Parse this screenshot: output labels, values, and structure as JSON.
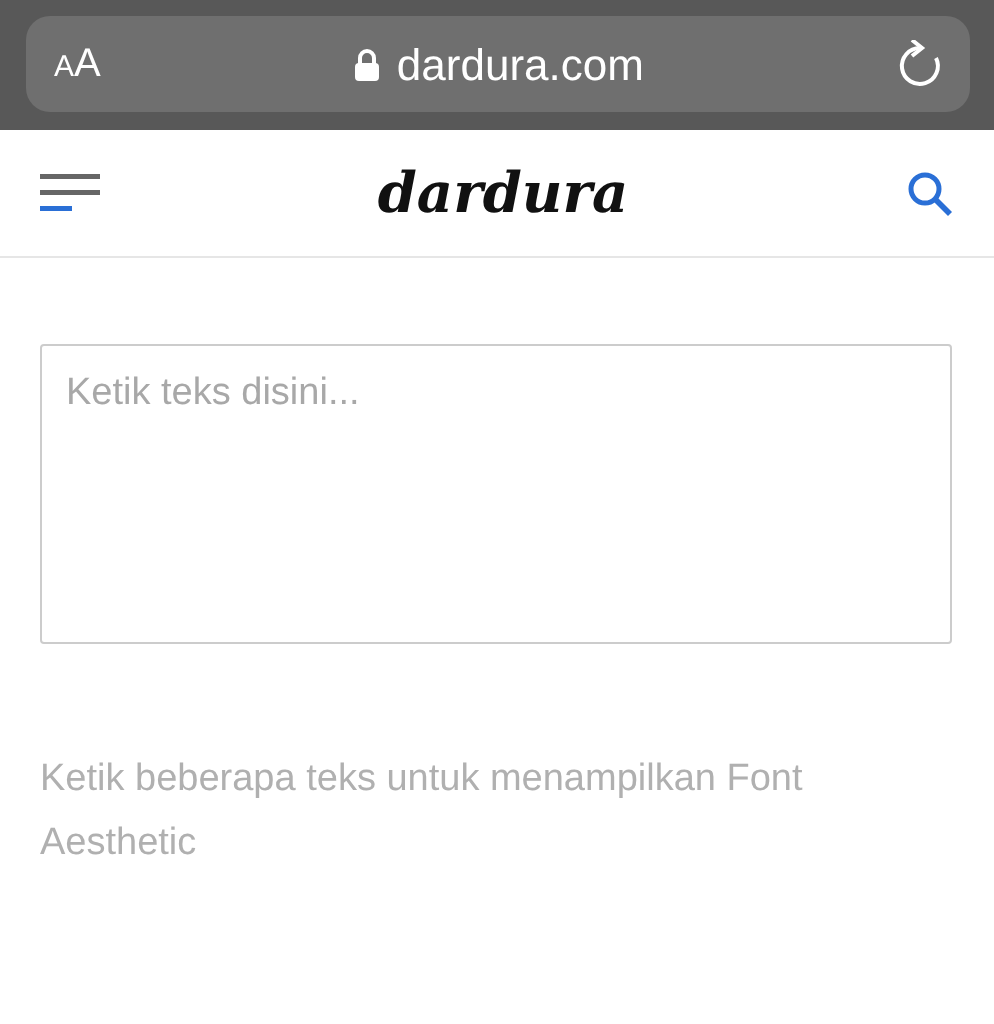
{
  "browser_bar": {
    "text_size_button": "AA",
    "url": "dardura.com"
  },
  "header": {
    "logo": "dardura"
  },
  "input": {
    "placeholder": "Ketik teks disini..."
  },
  "hint": "Ketik beberapa teks untuk menampilkan Font Aesthetic"
}
